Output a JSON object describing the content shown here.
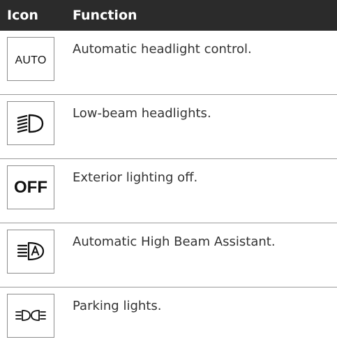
{
  "header": {
    "icon_col": "Icon",
    "function_col": "Function"
  },
  "rows": [
    {
      "icon_name": "auto-headlight-icon",
      "icon_text": "AUTO",
      "function": "Automatic headlight control."
    },
    {
      "icon_name": "low-beam-icon",
      "icon_text": "",
      "function": "Low-beam headlights."
    },
    {
      "icon_name": "lights-off-icon",
      "icon_text": "OFF",
      "function": "Exterior lighting off."
    },
    {
      "icon_name": "high-beam-assistant-icon",
      "icon_text": "",
      "function": "Automatic High Beam Assistant."
    },
    {
      "icon_name": "parking-lights-icon",
      "icon_text": "",
      "function": "Parking lights."
    }
  ],
  "colors": {
    "header_bg": "#2b2b2b",
    "header_text": "#ffffff",
    "body_text": "#333333",
    "divider": "#9a9a9a"
  }
}
